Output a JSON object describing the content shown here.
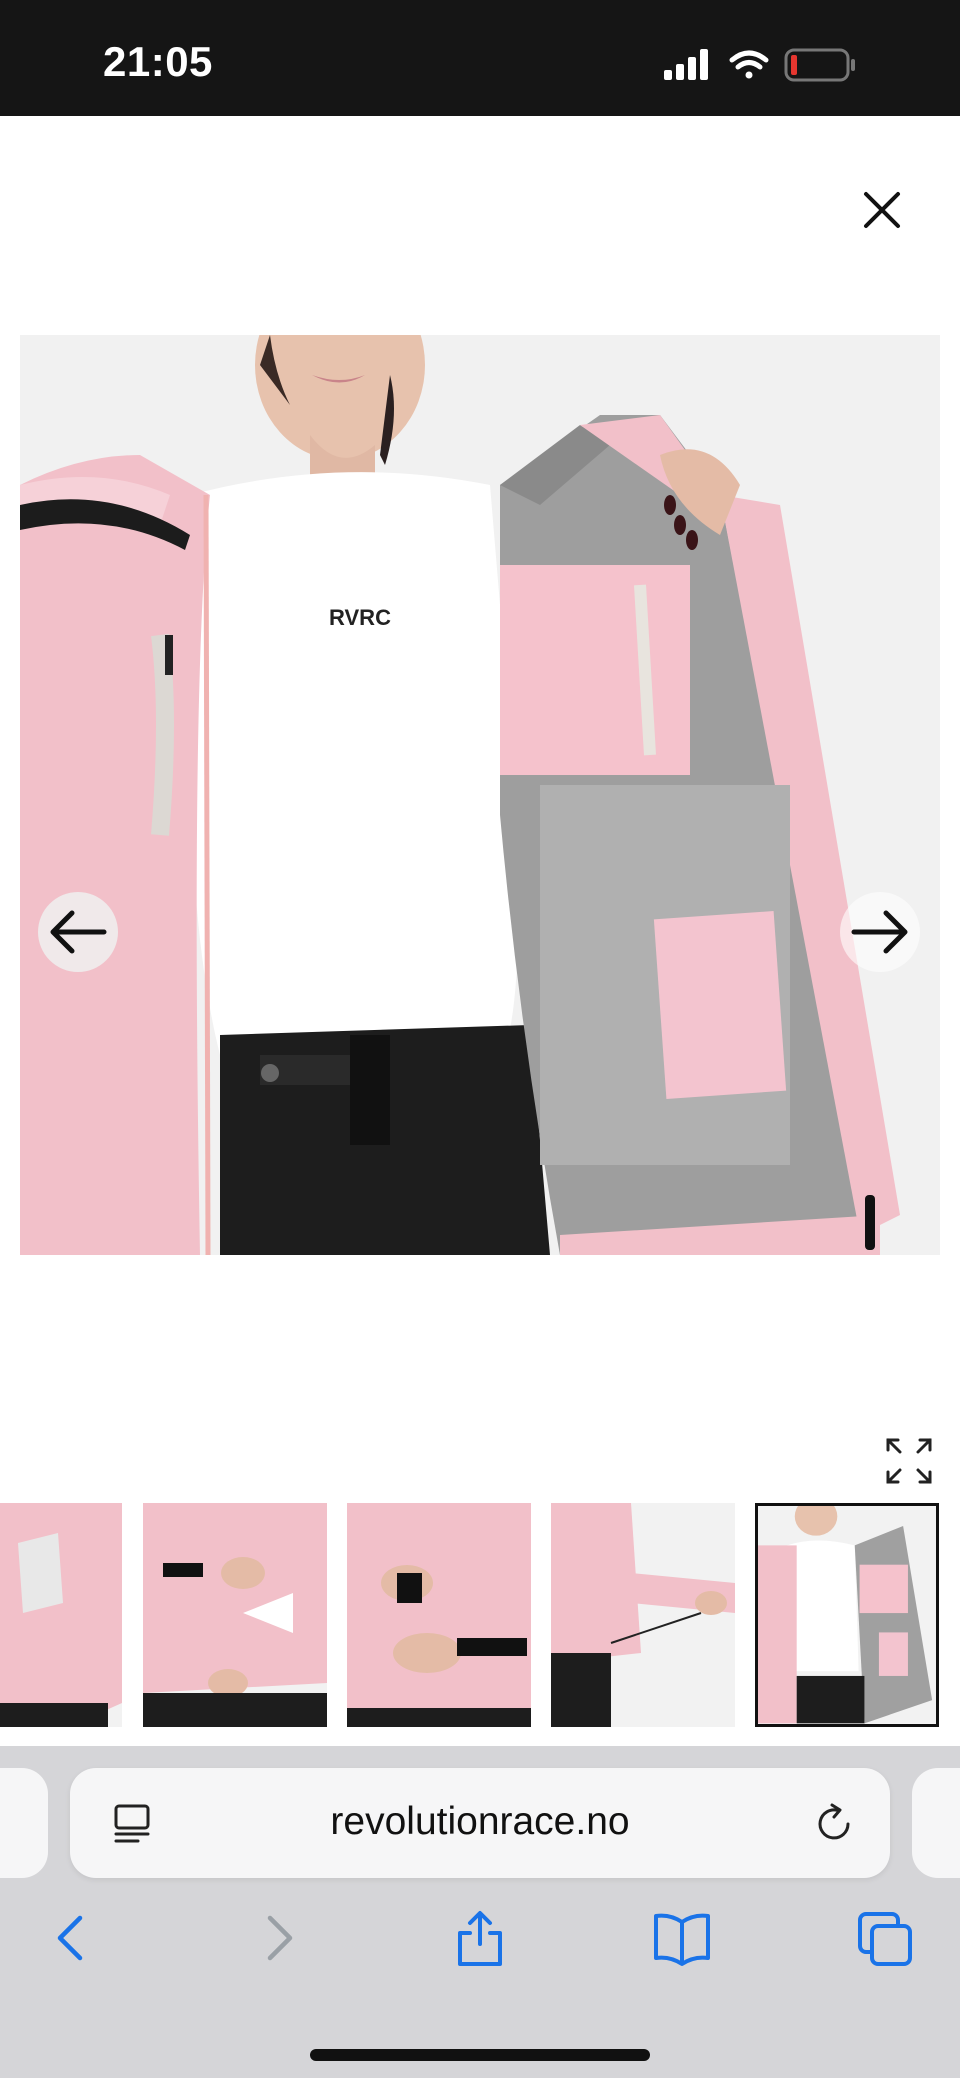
{
  "status_bar": {
    "time": "21:05",
    "icons": [
      "signal-icon",
      "wifi-icon",
      "battery-low-icon"
    ],
    "battery_color": "#e5362f"
  },
  "viewer": {
    "close_icon": "close-icon",
    "prev_icon": "arrow-left-icon",
    "next_icon": "arrow-right-icon",
    "expand_icon": "expand-icon",
    "image_subject": "pink shell jacket opened showing grey inner lining",
    "logo_text": "RVRC",
    "thumbnails_count": 5,
    "selected_thumbnail": 5
  },
  "browser": {
    "url": "revolutionrace.no",
    "reader_icon": "reader-mode-icon",
    "reload_icon": "reload-icon",
    "toolbar": [
      "back-icon",
      "forward-icon",
      "share-icon",
      "bookmarks-icon",
      "tabs-icon"
    ],
    "accent_color": "#1a73e8"
  }
}
